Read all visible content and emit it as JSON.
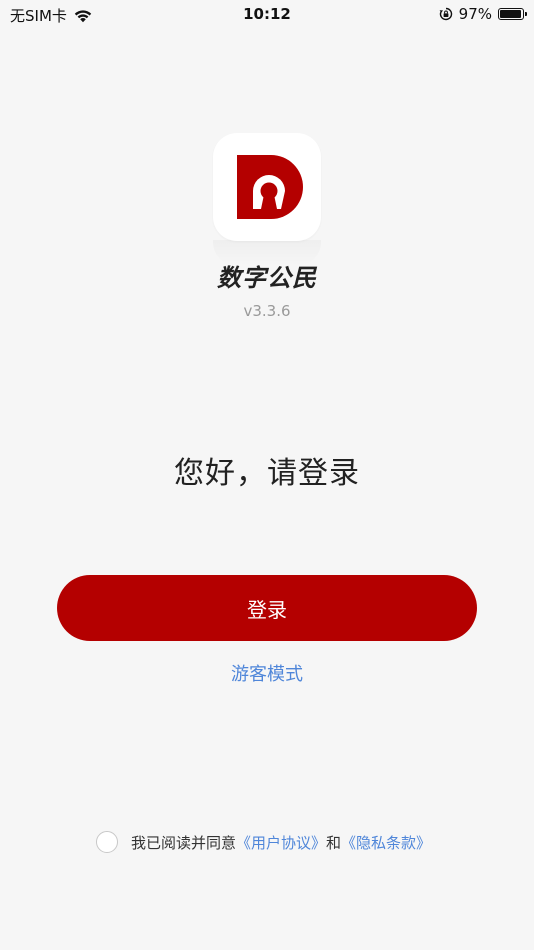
{
  "status_bar": {
    "carrier": "无SIM卡",
    "time": "10:12",
    "battery_percent": "97%",
    "battery_level": 0.97,
    "icons": [
      "wifi-icon",
      "rotation-lock-icon",
      "battery-icon"
    ]
  },
  "app": {
    "name": "数字公民",
    "version": "v3.3.6",
    "logo_icon": "app-logo-d-icon",
    "brand_color": "#b40000"
  },
  "greeting": "您好，请登录",
  "login_button": {
    "label": "登录",
    "color": "#b40000"
  },
  "guest_mode": {
    "label": "游客模式",
    "color": "#4f86d9"
  },
  "agreement": {
    "prefix": "我已阅读并同意",
    "user_agreement": "《用户协议》",
    "conjunction": "和",
    "privacy_policy": "《隐私条款》",
    "checked": false
  }
}
